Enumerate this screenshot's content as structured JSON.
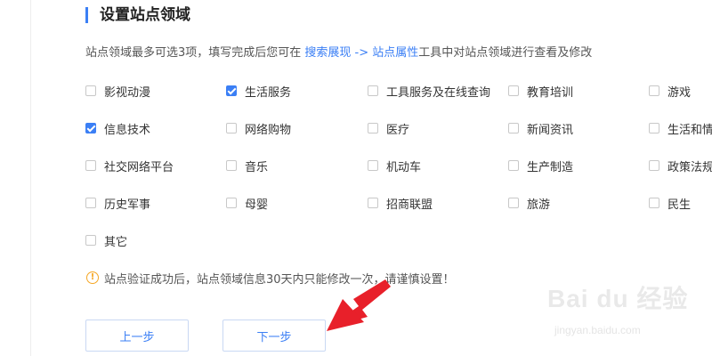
{
  "header": {
    "title": "设置站点领域"
  },
  "description": {
    "prefix": "站点领域最多可选3项，填写完成后您可在 ",
    "link": "搜索展现 -> 站点属性",
    "suffix": "工具中对站点领域进行查看及修改"
  },
  "options": [
    {
      "label": "影视动漫",
      "checked": false
    },
    {
      "label": "生活服务",
      "checked": true
    },
    {
      "label": "工具服务及在线查询",
      "checked": false
    },
    {
      "label": "教育培训",
      "checked": false
    },
    {
      "label": "游戏",
      "checked": false
    },
    {
      "label": "信息技术",
      "checked": true
    },
    {
      "label": "网络购物",
      "checked": false
    },
    {
      "label": "医疗",
      "checked": false
    },
    {
      "label": "新闻资讯",
      "checked": false
    },
    {
      "label": "生活和情",
      "checked": false
    },
    {
      "label": "社交网络平台",
      "checked": false
    },
    {
      "label": "音乐",
      "checked": false
    },
    {
      "label": "机动车",
      "checked": false
    },
    {
      "label": "生产制造",
      "checked": false
    },
    {
      "label": "政策法规",
      "checked": false
    },
    {
      "label": "历史军事",
      "checked": false
    },
    {
      "label": "母婴",
      "checked": false
    },
    {
      "label": "招商联盟",
      "checked": false
    },
    {
      "label": "旅游",
      "checked": false
    },
    {
      "label": "民生",
      "checked": false
    },
    {
      "label": "其它",
      "checked": false
    }
  ],
  "warning": {
    "text": "站点验证成功后，站点领域信息30天内只能修改一次，请谨慎设置！",
    "icon": "exclamation-circle-icon"
  },
  "buttons": {
    "prev_label": "上一步",
    "next_label": "下一步"
  },
  "watermark": {
    "main": "Bai du 经验",
    "sub": "jingyan.baidu.com"
  },
  "colors": {
    "accent": "#3b7ff5",
    "warning": "#f5a623",
    "arrow": "#e8202a"
  }
}
